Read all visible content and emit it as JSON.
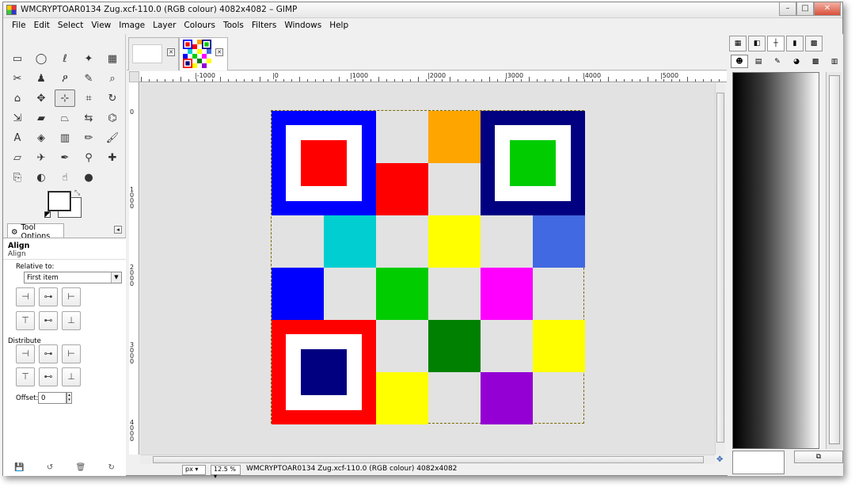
{
  "window": {
    "title": "WMCRYPTOAR0134 Zug.xcf-110.0 (RGB colour) 4082x4082 – GIMP",
    "controls": {
      "minimize": "–",
      "maximize": "□",
      "close": "✕"
    }
  },
  "menu": {
    "items": [
      {
        "label": "File"
      },
      {
        "label": "Edit"
      },
      {
        "label": "Select"
      },
      {
        "label": "View"
      },
      {
        "label": "Image"
      },
      {
        "label": "Layer"
      },
      {
        "label": "Colours"
      },
      {
        "label": "Tools"
      },
      {
        "label": "Filters"
      },
      {
        "label": "Windows"
      },
      {
        "label": "Help"
      }
    ]
  },
  "toolbox": {
    "tools": [
      {
        "name": "rect-select",
        "glyph": "▭"
      },
      {
        "name": "ellipse-select",
        "glyph": "◯"
      },
      {
        "name": "free-select",
        "glyph": "ℓ"
      },
      {
        "name": "fuzzy-select",
        "glyph": "✦"
      },
      {
        "name": "select-by-color",
        "glyph": "▦"
      },
      {
        "name": "scissors-select",
        "glyph": "✂"
      },
      {
        "name": "foreground-select",
        "glyph": "♟"
      },
      {
        "name": "paths",
        "glyph": "ዖ"
      },
      {
        "name": "color-picker",
        "glyph": "✎"
      },
      {
        "name": "zoom",
        "glyph": "⌕"
      },
      {
        "name": "measure",
        "glyph": "⌂"
      },
      {
        "name": "move",
        "glyph": "✥"
      },
      {
        "name": "align",
        "glyph": "⊹",
        "active": true
      },
      {
        "name": "crop",
        "glyph": "⌗"
      },
      {
        "name": "rotate",
        "glyph": "↻"
      },
      {
        "name": "scale",
        "glyph": "⇲"
      },
      {
        "name": "shear",
        "glyph": "▰"
      },
      {
        "name": "perspective",
        "glyph": "⏢"
      },
      {
        "name": "flip",
        "glyph": "⇆"
      },
      {
        "name": "cage",
        "glyph": "⌬"
      },
      {
        "name": "text",
        "glyph": "A"
      },
      {
        "name": "bucket-fill",
        "glyph": "◈"
      },
      {
        "name": "blend",
        "glyph": "▥"
      },
      {
        "name": "pencil",
        "glyph": "✏"
      },
      {
        "name": "paintbrush",
        "glyph": "🖌"
      },
      {
        "name": "eraser",
        "glyph": "▱"
      },
      {
        "name": "airbrush",
        "glyph": "✈"
      },
      {
        "name": "ink",
        "glyph": "✒"
      },
      {
        "name": "clone",
        "glyph": "⚲"
      },
      {
        "name": "heal",
        "glyph": "✚"
      },
      {
        "name": "perspective-clone",
        "glyph": "⎘"
      },
      {
        "name": "blur",
        "glyph": "◐"
      },
      {
        "name": "smudge",
        "glyph": "☝"
      },
      {
        "name": "dodge-burn",
        "glyph": "●"
      }
    ],
    "swap_glyph": "⤡"
  },
  "tool_options": {
    "tab_label": "Tool Options",
    "collapse_glyph": "◂",
    "title": "Align",
    "subtitle": "Align",
    "relative_to_label": "Relative to:",
    "relative_to_value": "First item",
    "distribute_label": "Distribute",
    "offset_label": "Offset:",
    "offset_value": "0",
    "align_buttons": [
      "⊣",
      "⊶",
      "⊢",
      "⊤",
      "⊷",
      "⊥"
    ],
    "distribute_buttons": [
      "⊣",
      "⊶",
      "⊢",
      "⊤",
      "⊷",
      "⊥"
    ],
    "bottom_icons": [
      "💾",
      "↺",
      "🗑",
      "↻"
    ]
  },
  "image_window": {
    "tabs": [
      {
        "name": "blank-image-tab"
      },
      {
        "name": "wmcryptoar-tab",
        "active": true
      }
    ],
    "ruler_h_labels": [
      "-1000",
      "0",
      "1000",
      "2000",
      "3000",
      "4000",
      "5000"
    ],
    "ruler_v_labels": [
      "0",
      "1000",
      "2000",
      "3000",
      "4000"
    ],
    "unit": "px",
    "zoom": "12.5 %",
    "status": "WMCRYPTOAR0134 Zug.xcf-110.0 (RGB colour) 4082x4082"
  },
  "artwork": {
    "grid_size": 6,
    "cells": [
      {
        "r": 0,
        "c": 3,
        "color": "#ffa500"
      },
      {
        "r": 1,
        "c": 2,
        "color": "#ff0000"
      },
      {
        "r": 2,
        "c": 1,
        "color": "#00ced1"
      },
      {
        "r": 2,
        "c": 3,
        "color": "#ffff00"
      },
      {
        "r": 2,
        "c": 5,
        "color": "#4169e1"
      },
      {
        "r": 3,
        "c": 0,
        "color": "#0000ff"
      },
      {
        "r": 3,
        "c": 2,
        "color": "#00cc00"
      },
      {
        "r": 3,
        "c": 4,
        "color": "#ff00ff"
      },
      {
        "r": 4,
        "c": 3,
        "color": "#008000"
      },
      {
        "r": 4,
        "c": 5,
        "color": "#ffff00"
      },
      {
        "r": 5,
        "c": 2,
        "color": "#ffff00"
      },
      {
        "r": 5,
        "c": 4,
        "color": "#9400d3"
      }
    ],
    "finders": [
      {
        "name": "finder-top-left",
        "r": 0,
        "c": 0,
        "outer": "#0000ff",
        "inner": "#ff0000"
      },
      {
        "name": "finder-top-right",
        "r": 0,
        "c": 4,
        "outer": "#000080",
        "inner": "#00cc00"
      },
      {
        "name": "finder-bottom-left",
        "r": 4,
        "c": 0,
        "outer": "#ff0000",
        "inner": "#000080"
      }
    ]
  },
  "dock": {
    "top_tabs": [
      "▦",
      "◧",
      "┼",
      "▮",
      "▩"
    ],
    "second_tabs": [
      "☻",
      "▤",
      "✎",
      "◕",
      "▩",
      "▥"
    ],
    "bottom_button": "⧉"
  }
}
